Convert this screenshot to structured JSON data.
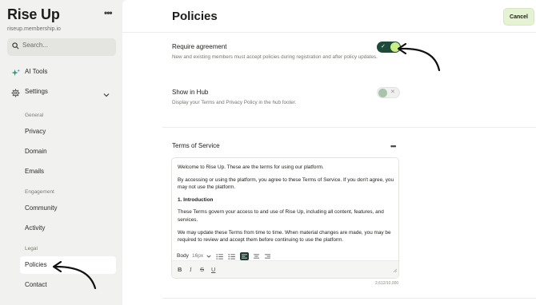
{
  "sidebar": {
    "brand": "Rise Up",
    "domain_url": "riseup.membership.io",
    "search_placeholder": "Search...",
    "ai_tools": "AI Tools",
    "settings": "Settings",
    "sections": {
      "general": "General",
      "engagement": "Engagement",
      "legal": "Legal"
    },
    "items": {
      "privacy": "Privacy",
      "domain": "Domain",
      "emails": "Emails",
      "community": "Community",
      "activity": "Activity",
      "policies": "Policies",
      "contact": "Contact"
    }
  },
  "header": {
    "title": "Policies",
    "cancel": "Cancel"
  },
  "settings": {
    "require_agreement": {
      "title": "Require agreement",
      "description": "New and existing members must accept policies during registration and after policy updates.",
      "enabled": true
    },
    "show_in_hub": {
      "title": "Show in Hub",
      "description": "Display your Terms and Privacy Policy in the hub footer.",
      "enabled": false
    }
  },
  "terms": {
    "title": "Terms of Service",
    "paragraphs": [
      "Welcome to Rise Up. These are the terms for using our platform.",
      "By accessing or using the platform, you agree to these Terms of Service. If you don't agree, you may not use the platform.",
      "1. Introduction",
      "These Terms govern your access to and use of Rise Up, including all content, features, and services.",
      "We may update these Terms from time to time. When material changes are made, you may be required to review and accept them before continuing to use the platform."
    ],
    "toolbar": {
      "style": "Body",
      "size": "16px"
    },
    "char_count": "2,612/10,000"
  },
  "colors": {
    "accent_dark": "#1e4a3a",
    "accent_light": "#c9ee88",
    "cancel_bg": "#e6f3d2"
  }
}
